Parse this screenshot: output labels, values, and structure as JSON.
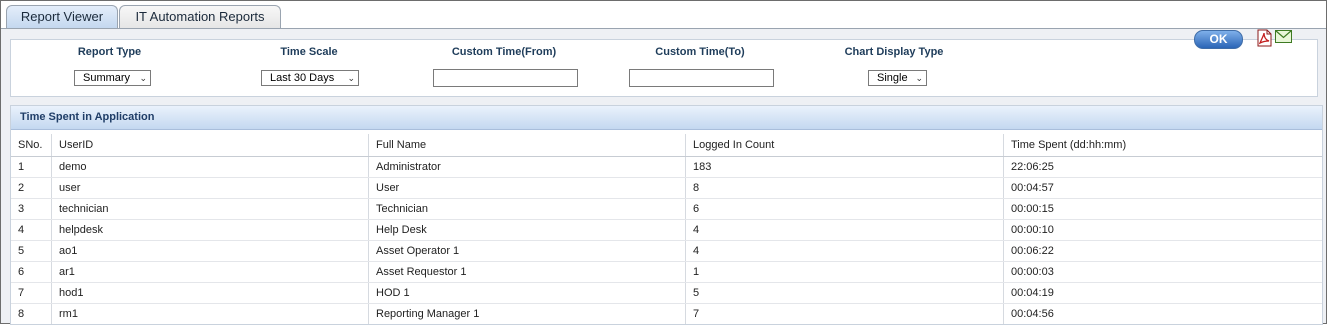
{
  "tabs": [
    {
      "label": "Report Viewer",
      "active": true
    },
    {
      "label": "IT Automation Reports",
      "active": false
    }
  ],
  "filters": {
    "report_type": {
      "label": "Report Type",
      "value": "Summary"
    },
    "time_scale": {
      "label": "Time Scale",
      "value": "Last 30 Days"
    },
    "custom_from": {
      "label": "Custom Time(From)",
      "value": ""
    },
    "custom_to": {
      "label": "Custom Time(To)",
      "value": ""
    },
    "chart_display_type": {
      "label": "Chart Display Type",
      "value": "Single"
    },
    "ok_label": "OK"
  },
  "icons": {
    "export": "pdf-icon",
    "email": "mail-icon"
  },
  "colors": {
    "accent": "#2b65b6",
    "header_text": "#1f3d67"
  },
  "report": {
    "title": "Time Spent in Application",
    "columns": [
      "SNo.",
      "UserID",
      "Full Name",
      "Logged In Count",
      "Time Spent (dd:hh:mm)"
    ],
    "rows": [
      [
        "1",
        "demo",
        "Administrator",
        "183",
        "22:06:25"
      ],
      [
        "2",
        "user",
        "User",
        "8",
        "00:04:57"
      ],
      [
        "3",
        "technician",
        "Technician",
        "6",
        "00:00:15"
      ],
      [
        "4",
        "helpdesk",
        "Help Desk",
        "4",
        "00:00:10"
      ],
      [
        "5",
        "ao1",
        "Asset Operator 1",
        "4",
        "00:06:22"
      ],
      [
        "6",
        "ar1",
        "Asset Requestor 1",
        "1",
        "00:00:03"
      ],
      [
        "7",
        "hod1",
        "HOD 1",
        "5",
        "00:04:19"
      ],
      [
        "8",
        "rm1",
        "Reporting Manager 1",
        "7",
        "00:04:56"
      ]
    ]
  }
}
